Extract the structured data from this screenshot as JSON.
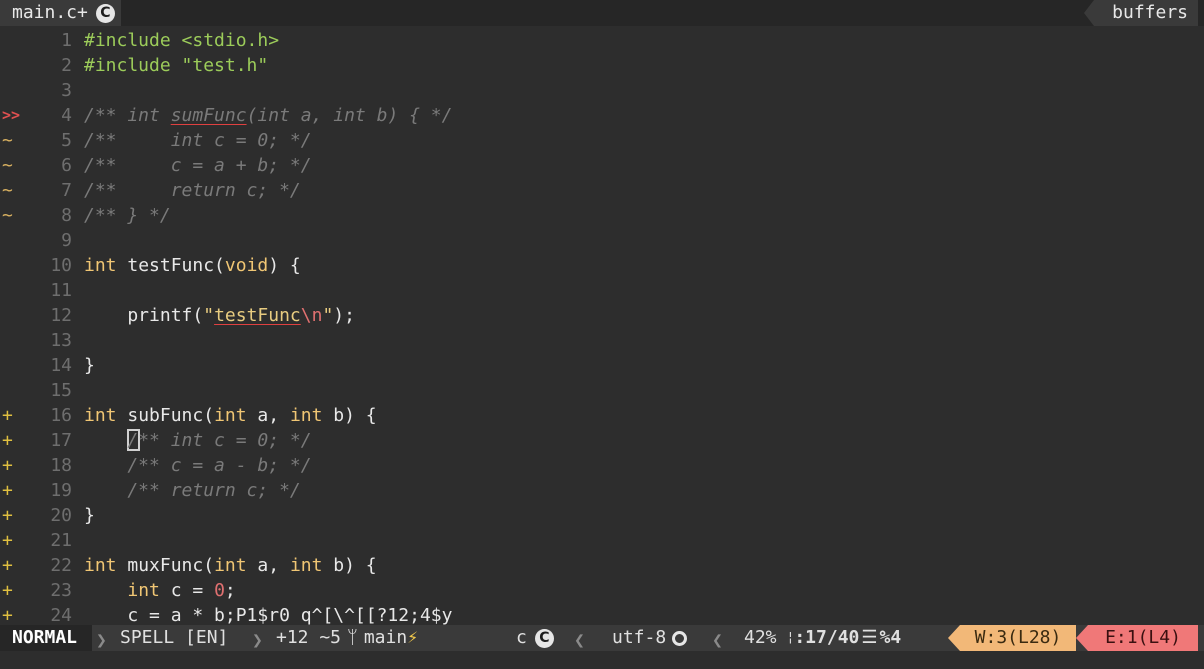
{
  "tabline": {
    "active_tab": "main.c+",
    "active_tab_icon": "c-language-icon",
    "buffers_label": "buffers"
  },
  "lines": [
    {
      "num": "1",
      "sign": "",
      "segments": [
        {
          "t": "#include <stdio.h>",
          "c": "pp"
        }
      ]
    },
    {
      "num": "2",
      "sign": "",
      "segments": [
        {
          "t": "#include \"test.h\"",
          "c": "pp"
        }
      ]
    },
    {
      "num": "3",
      "sign": "",
      "segments": []
    },
    {
      "num": "4",
      "sign": ">>",
      "sign_type": "err",
      "segments": [
        {
          "t": "/** int ",
          "c": "cm"
        },
        {
          "t": "sumFunc",
          "c": "cm spell"
        },
        {
          "t": "(int a, int b) { */",
          "c": "cm"
        }
      ]
    },
    {
      "num": "5",
      "sign": "~",
      "sign_type": "mod",
      "segments": [
        {
          "t": "/**     int c = 0; */",
          "c": "cm"
        }
      ]
    },
    {
      "num": "6",
      "sign": "~",
      "sign_type": "mod",
      "segments": [
        {
          "t": "/**     c = a + b; */",
          "c": "cm"
        }
      ]
    },
    {
      "num": "7",
      "sign": "~",
      "sign_type": "mod",
      "segments": [
        {
          "t": "/**     return c; */",
          "c": "cm"
        }
      ]
    },
    {
      "num": "8",
      "sign": "~",
      "sign_type": "mod",
      "segments": [
        {
          "t": "/** } */",
          "c": "cm"
        }
      ]
    },
    {
      "num": "9",
      "sign": "",
      "segments": []
    },
    {
      "num": "10",
      "sign": "",
      "segments": [
        {
          "t": "int",
          "c": "kw"
        },
        {
          "t": " testFunc(",
          "c": "fn"
        },
        {
          "t": "void",
          "c": "kw"
        },
        {
          "t": ") {",
          "c": "fn"
        }
      ]
    },
    {
      "num": "11",
      "sign": "",
      "segments": []
    },
    {
      "num": "12",
      "sign": "",
      "segments": [
        {
          "t": "    printf(",
          "c": "fn"
        },
        {
          "t": "\"",
          "c": "str"
        },
        {
          "t": "testFunc",
          "c": "str spell"
        },
        {
          "t": "\\n",
          "c": "esc"
        },
        {
          "t": "\"",
          "c": "str"
        },
        {
          "t": ");",
          "c": "fn"
        }
      ]
    },
    {
      "num": "13",
      "sign": "",
      "segments": []
    },
    {
      "num": "14",
      "sign": "",
      "segments": [
        {
          "t": "}",
          "c": "fn"
        }
      ]
    },
    {
      "num": "15",
      "sign": "",
      "segments": []
    },
    {
      "num": "16",
      "sign": "+",
      "sign_type": "add",
      "segments": [
        {
          "t": "int",
          "c": "kw"
        },
        {
          "t": " subFunc(",
          "c": "fn"
        },
        {
          "t": "int",
          "c": "kw"
        },
        {
          "t": " a, ",
          "c": "fn"
        },
        {
          "t": "int",
          "c": "kw"
        },
        {
          "t": " b) {",
          "c": "fn"
        }
      ]
    },
    {
      "num": "17",
      "sign": "+",
      "sign_type": "add",
      "cursor": true,
      "segments": [
        {
          "t": "    ",
          "c": "fn"
        },
        {
          "t": "/** int c = 0; */",
          "c": "cm"
        }
      ]
    },
    {
      "num": "18",
      "sign": "+",
      "sign_type": "add",
      "segments": [
        {
          "t": "    /** c = a - b; */",
          "c": "cm"
        }
      ]
    },
    {
      "num": "19",
      "sign": "+",
      "sign_type": "add",
      "segments": [
        {
          "t": "    /** return c; */",
          "c": "cm"
        }
      ]
    },
    {
      "num": "20",
      "sign": "+",
      "sign_type": "add",
      "segments": [
        {
          "t": "}",
          "c": "fn"
        }
      ]
    },
    {
      "num": "21",
      "sign": "+",
      "sign_type": "add",
      "segments": []
    },
    {
      "num": "22",
      "sign": "+",
      "sign_type": "add",
      "segments": [
        {
          "t": "int",
          "c": "kw"
        },
        {
          "t": " muxFunc(",
          "c": "fn"
        },
        {
          "t": "int",
          "c": "kw"
        },
        {
          "t": " a, ",
          "c": "fn"
        },
        {
          "t": "int",
          "c": "kw"
        },
        {
          "t": " b) {",
          "c": "fn"
        }
      ]
    },
    {
      "num": "23",
      "sign": "+",
      "sign_type": "add",
      "segments": [
        {
          "t": "    ",
          "c": "fn"
        },
        {
          "t": "int",
          "c": "kw"
        },
        {
          "t": " c = ",
          "c": "fn"
        },
        {
          "t": "0",
          "c": "num"
        },
        {
          "t": ";",
          "c": "fn"
        }
      ]
    },
    {
      "num": "24",
      "sign": "+",
      "sign_type": "add",
      "segments": [
        {
          "t": "    c = a * b;P1$r0 q^[\\^[[?12;4$y",
          "c": "fn"
        }
      ]
    }
  ],
  "statusline": {
    "mode": "NORMAL",
    "spell": "SPELL [EN]",
    "git_diff": "+12 ~5",
    "git_branch": "main",
    "filetype": "c",
    "encoding": "utf-8",
    "percent": "42%",
    "position": ":17/40",
    "column": "4",
    "warnings": "W:3(L28)",
    "errors": "E:1(L4)"
  },
  "colors": {
    "background": "#2d2d2d",
    "keyword": "#f0c674",
    "preprocessor": "#9ccc5a",
    "comment": "#7a7a7a",
    "warning_bg": "#f2b878",
    "error_bg": "#f07878"
  }
}
